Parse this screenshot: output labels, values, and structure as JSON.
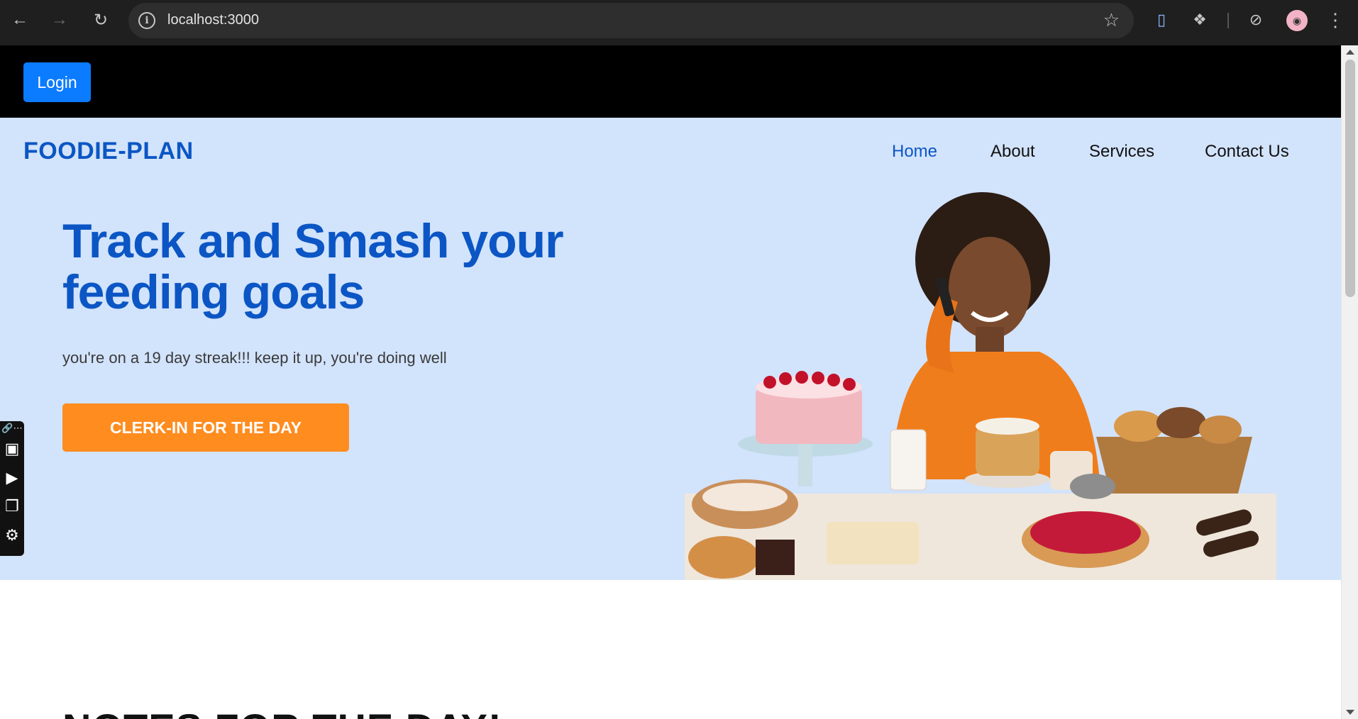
{
  "browser": {
    "url": "localhost:3000",
    "icons": [
      "back-arrow-icon",
      "forward-arrow-icon",
      "reload-icon",
      "info-icon",
      "star-icon",
      "extension-icon",
      "puzzle-icon",
      "performance-icon",
      "profile-avatar-icon",
      "more-vert-icon"
    ]
  },
  "topbar": {
    "login_label": "Login"
  },
  "header": {
    "brand": "FOODIE-PLAN",
    "nav": [
      {
        "label": "Home",
        "active": true
      },
      {
        "label": "About",
        "active": false
      },
      {
        "label": "Services",
        "active": false
      },
      {
        "label": "Contact Us",
        "active": false
      }
    ]
  },
  "hero": {
    "headline_line1": "Track and Smash your",
    "headline_line2": "feeding goals",
    "subtext": "you're on a 19 day streak!!! keep it up, you're doing well",
    "cta_label": "CLERK-IN FOR THE DAY"
  },
  "notes": {
    "title": "NOTES FOR THE DAY!"
  },
  "colors": {
    "brand_blue": "#0b56c4",
    "hero_bg": "#d2e3fc",
    "cta_orange": "#ff8c1f",
    "login_blue": "#0b7bff"
  }
}
